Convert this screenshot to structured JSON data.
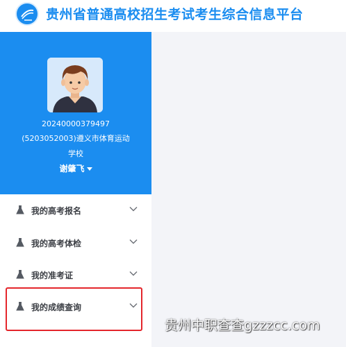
{
  "header": {
    "title": "贵州省普通高校招生考试考生综合信息平台",
    "logo_icon": "exam-logo-icon"
  },
  "profile": {
    "student_id": "20240000379497",
    "school_line1": "(5203052003)遵义市体育运动",
    "school_line2": "学校",
    "name": "谢肇飞"
  },
  "menu": {
    "items": [
      {
        "label": "我的高考报名",
        "icon": "flask-icon"
      },
      {
        "label": "我的高考体检",
        "icon": "flask-icon"
      },
      {
        "label": "我的准考证",
        "icon": "flask-icon"
      },
      {
        "label": "我的成绩查询",
        "icon": "flask-icon"
      }
    ]
  },
  "watermark": "贵州中职查查gzzzcc.com",
  "colors": {
    "brand_blue": "#1b8df0",
    "highlight_red": "#e4252b",
    "content_bg": "#f3f4f8"
  }
}
